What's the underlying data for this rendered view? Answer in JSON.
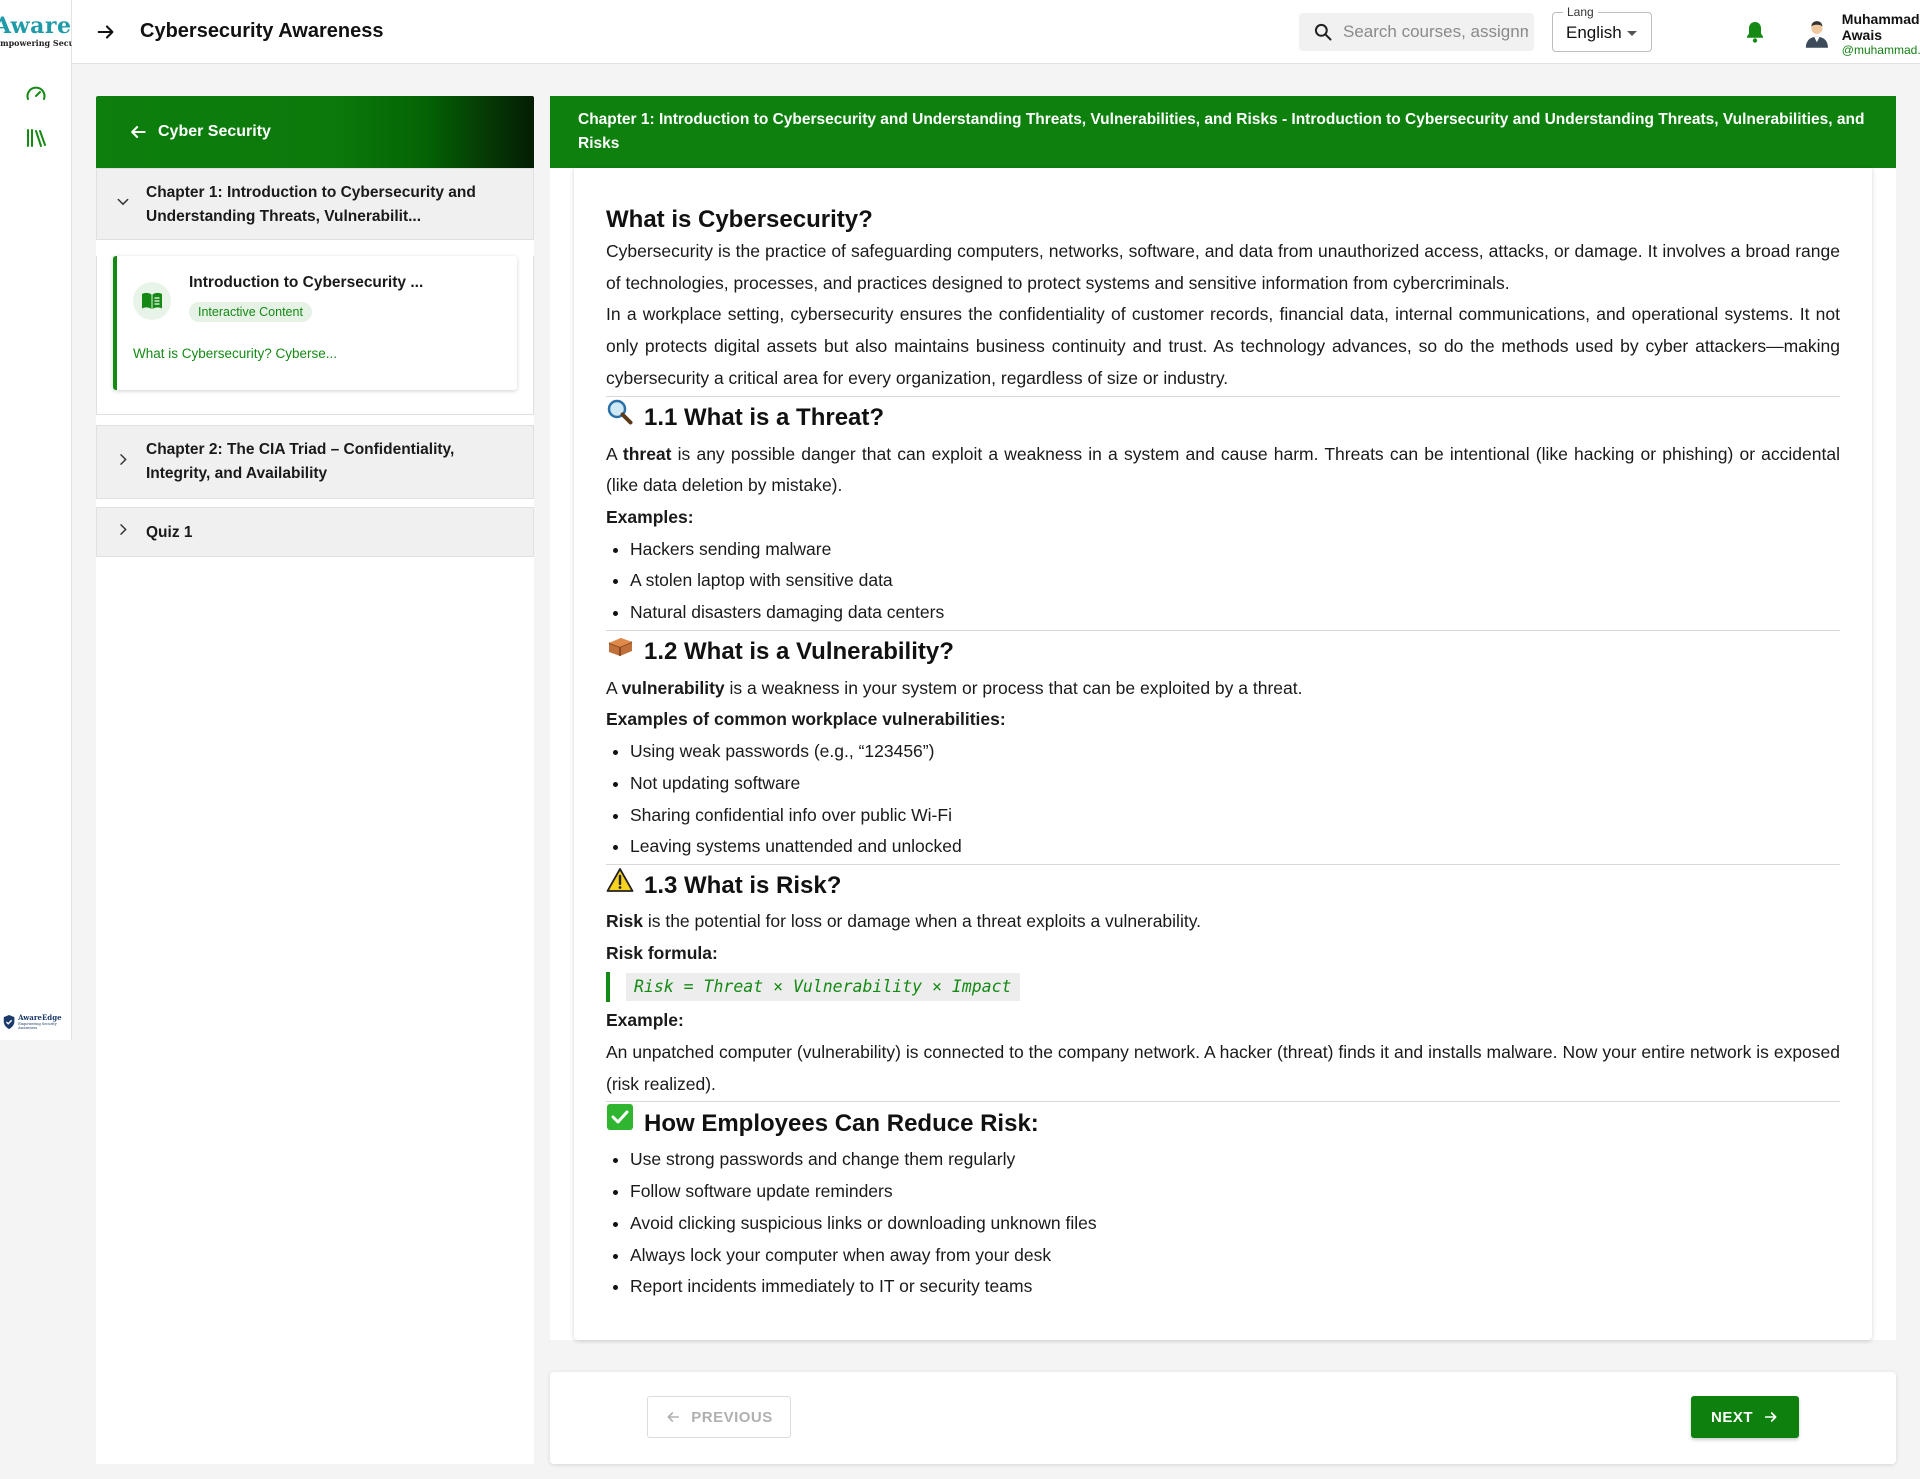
{
  "brand": {
    "logo_word": "AwareEdge",
    "logo_tagline": "Empowering Security",
    "footer_logo_text": "AwareEdge",
    "footer_logo_tagline": "Empowering Security Awareness"
  },
  "rail": {
    "icons": [
      "dashboard-gauge-icon",
      "library-books-icon"
    ]
  },
  "topbar": {
    "title": "Cybersecurity Awareness",
    "search_placeholder": "Search courses, assignments...",
    "lang_label": "Lang",
    "lang_value": "English",
    "user_name": "Muhammad Awais",
    "user_handle": "@muhammad.awais"
  },
  "sidebar": {
    "back_label": "Cyber Security",
    "chapters": [
      {
        "title": "Chapter 1: Introduction to Cybersecurity and Understanding Threats, Vulnerabilit...",
        "expanded": true,
        "lessons": [
          {
            "title": "Introduction to Cybersecurity ...",
            "type": "Interactive Content",
            "snippet": "What is Cybersecurity? Cyberse..."
          }
        ]
      },
      {
        "title": "Chapter 2: The CIA Triad – Confidentiality, Integrity, and Availability",
        "expanded": false
      },
      {
        "title": "Quiz 1",
        "expanded": false
      }
    ]
  },
  "main": {
    "header": "Chapter 1: Introduction to Cybersecurity and Understanding Threats, Vulnerabilities, and Risks - Introduction to Cybersecurity and Understanding Threats, Vulnerabilities, and Risks",
    "h_what": "What is Cybersecurity?",
    "p_what_1": "Cybersecurity is the practice of safeguarding computers, networks, software, and data from unauthorized access, attacks, or damage. It involves a broad range of technologies, processes, and practices designed to protect systems and sensitive information from cybercriminals.",
    "p_what_2": "In a workplace setting, cybersecurity ensures the confidentiality of customer records, financial data, internal communications, and operational systems. It not only protects digital assets but also maintains business continuity and trust. As technology advances, so do the methods used by cyber attackers—making cybersecurity a critical area for every organization, regardless of size or industry.",
    "threat": {
      "heading": "1.1 What is a Threat?",
      "p_pre": "A ",
      "p_bold": "threat",
      "p_post": " is any possible danger that can exploit a weakness in a system and cause harm. Threats can be intentional (like hacking or phishing) or accidental (like data deletion by mistake).",
      "examples_label": "Examples:",
      "examples": [
        "Hackers sending malware",
        "A stolen laptop with sensitive data",
        "Natural disasters damaging data centers"
      ]
    },
    "vuln": {
      "heading": "1.2 What is a Vulnerability?",
      "p_pre": "A ",
      "p_bold": "vulnerability",
      "p_post": " is a weakness in your system or process that can be exploited by a threat.",
      "examples_label": "Examples of common workplace vulnerabilities:",
      "examples": [
        "Using weak passwords (e.g., “123456”)",
        "Not updating software",
        "Sharing confidential info over public Wi-Fi",
        "Leaving systems unattended and unlocked"
      ]
    },
    "risk": {
      "heading": "1.3 What is Risk?",
      "p_bold": "Risk",
      "p_post": " is the potential for loss or damage when a threat exploits a vulnerability.",
      "formula_label": "Risk formula:",
      "formula": "Risk = Threat × Vulnerability × Impact",
      "example_label": "Example:",
      "example": "An unpatched computer (vulnerability) is connected to the company network. A hacker (threat) finds it and installs malware. Now your entire network is exposed (risk realized)."
    },
    "reduce": {
      "heading": "How Employees Can Reduce Risk:",
      "items": [
        "Use strong passwords and change them regularly",
        "Follow software update reminders",
        "Avoid clicking suspicious links or downloading unknown files",
        "Always lock your computer when away from your desk",
        "Report incidents immediately to IT or security teams"
      ]
    }
  },
  "pager": {
    "prev_label": "PREVIOUS",
    "next_label": "NEXT"
  },
  "colors": {
    "brand_green": "#0d800d",
    "accent_green": "#148a14",
    "logo_teal": "#1f9aa8"
  }
}
